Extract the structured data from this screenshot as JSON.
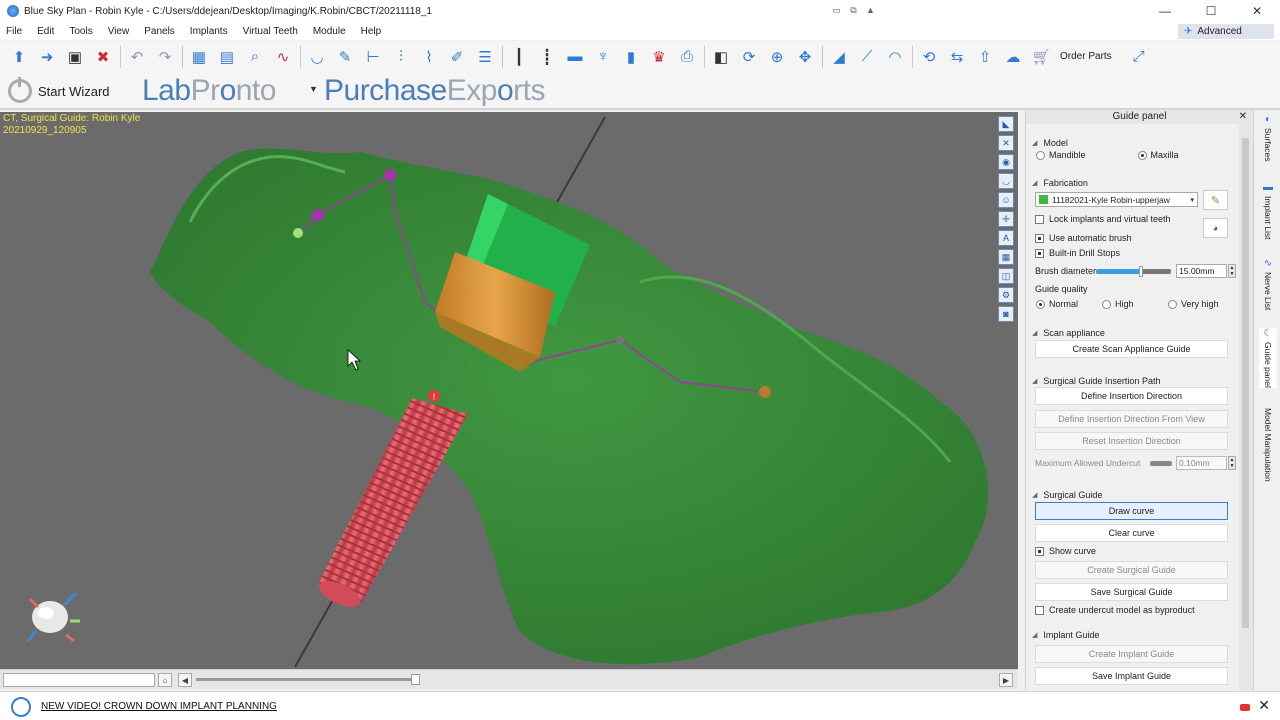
{
  "window": {
    "title": "Blue Sky Plan - Robin Kyle - C:/Users/ddejean/Desktop/Imaging/K.Robin/CBCT/20211118_1",
    "min": "—",
    "max": "☐",
    "close": "✕"
  },
  "menu": [
    "File",
    "Edit",
    "Tools",
    "View",
    "Panels",
    "Implants",
    "Virtual Teeth",
    "Module",
    "Help"
  ],
  "advanced_label": "Advanced",
  "toolbar": {
    "order_parts_label": "Order Parts"
  },
  "wizard": {
    "start_wizard_label": "Start Wizard",
    "labpronto_a": "Lab",
    "labpronto_b": "Pr",
    "labpronto_c": "nto",
    "purchase_a": "Purchase",
    "purchase_b": "Exp",
    "purchase_c": "rts"
  },
  "viewport": {
    "info_line1": "CT, Surgical Guide: Robin Kyle",
    "info_line2": "20210929_120905"
  },
  "guide_panel": {
    "title": "Guide panel",
    "model": {
      "heading": "Model",
      "mandible": "Mandible",
      "maxilla": "Maxilla",
      "selected": "Maxilla"
    },
    "fabrication": {
      "heading": "Fabrication",
      "selected_model": "11182021-Kyle Robin-upperjaw",
      "lock_label": "Lock implants and virtual teeth",
      "auto_brush_label": "Use automatic brush",
      "drill_stops_label": "Built-in Drill Stops",
      "brush_diameter_label": "Brush diameter",
      "brush_diameter_value": "15.00mm",
      "brush_level": 0.6,
      "guide_quality_label": "Guide quality",
      "quality_normal": "Normal",
      "quality_high": "High",
      "quality_very_high": "Very high"
    },
    "scan_appliance": {
      "heading": "Scan appliance",
      "create_btn": "Create Scan Appliance Guide"
    },
    "insertion_path": {
      "heading": "Surgical Guide Insertion Path",
      "define_btn": "Define Insertion Direction",
      "define_view_btn": "Define Insertion Direction From View",
      "reset_btn": "Reset Insertion Direction",
      "max_undercut_label": "Maximum Allowed Undercut",
      "max_undercut_value": "0.10mm"
    },
    "surgical_guide": {
      "heading": "Surgical Guide",
      "draw_curve_btn": "Draw curve",
      "clear_curve_btn": "Clear curve",
      "show_curve_label": "Show curve",
      "create_btn": "Create Surgical Guide",
      "save_btn": "Save Surgical Guide",
      "undercut_label": "Create undercut model as byproduct"
    },
    "implant_guide": {
      "heading": "Implant Guide",
      "create_btn": "Create Implant Guide",
      "save_btn": "Save Implant Guide"
    }
  },
  "side_tabs": [
    "Surfaces",
    "Implant List",
    "Nerve List",
    "Guide panel",
    "Model Manipulation"
  ],
  "status": {
    "news_link": "NEW VIDEO! CROWN DOWN IMPLANT PLANNING"
  }
}
